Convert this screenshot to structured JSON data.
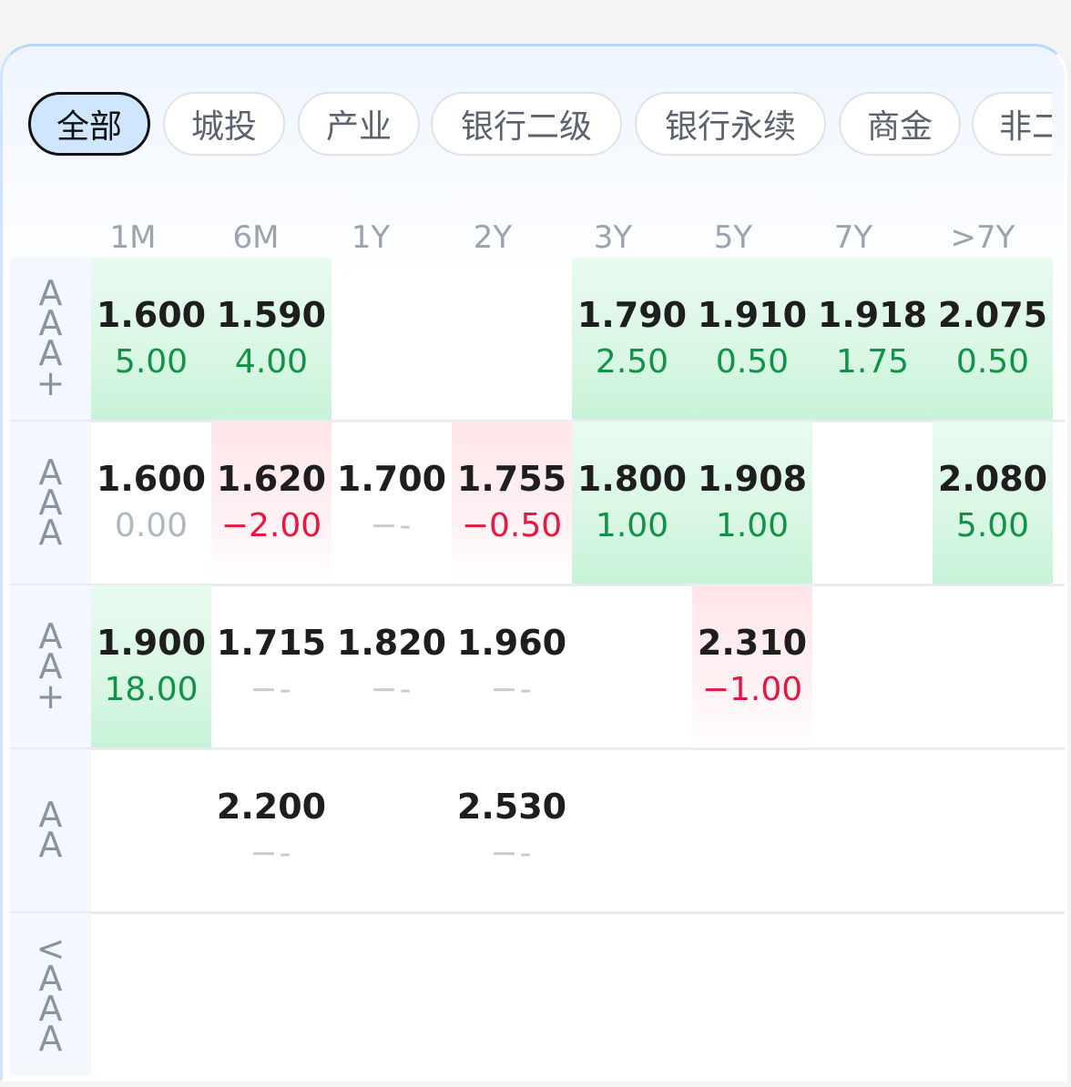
{
  "tabs": [
    "全部",
    "城投",
    "产业",
    "银行二级",
    "银行永续",
    "商金",
    "非二"
  ],
  "active_tab": 0,
  "columns": [
    "1M",
    "6M",
    "1Y",
    "2Y",
    "3Y",
    "5Y",
    "7Y",
    ">7Y"
  ],
  "rows": [
    {
      "label": [
        "A",
        "A",
        "A",
        "+"
      ],
      "cells": [
        {
          "yield": "1.600",
          "change": "5.00",
          "trend": "up"
        },
        {
          "yield": "1.590",
          "change": "4.00",
          "trend": "up"
        },
        null,
        null,
        {
          "yield": "1.790",
          "change": "2.50",
          "trend": "up"
        },
        {
          "yield": "1.910",
          "change": "0.50",
          "trend": "up"
        },
        {
          "yield": "1.918",
          "change": "1.75",
          "trend": "up"
        },
        {
          "yield": "2.075",
          "change": "0.50",
          "trend": "up"
        }
      ]
    },
    {
      "label": [
        "A",
        "A",
        "A"
      ],
      "cells": [
        {
          "yield": "1.600",
          "change": "0.00",
          "trend": "zero"
        },
        {
          "yield": "1.620",
          "change": "-2.00",
          "trend": "down"
        },
        {
          "yield": "1.700",
          "change": "--",
          "trend": "none"
        },
        {
          "yield": "1.755",
          "change": "-0.50",
          "trend": "down"
        },
        {
          "yield": "1.800",
          "change": "1.00",
          "trend": "up"
        },
        {
          "yield": "1.908",
          "change": "1.00",
          "trend": "up"
        },
        null,
        {
          "yield": "2.080",
          "change": "5.00",
          "trend": "up"
        }
      ]
    },
    {
      "label": [
        "A",
        "A",
        "+"
      ],
      "cells": [
        {
          "yield": "1.900",
          "change": "18.00",
          "trend": "up"
        },
        {
          "yield": "1.715",
          "change": "--",
          "trend": "none"
        },
        {
          "yield": "1.820",
          "change": "--",
          "trend": "none"
        },
        {
          "yield": "1.960",
          "change": "--",
          "trend": "none"
        },
        null,
        {
          "yield": "2.310",
          "change": "-1.00",
          "trend": "down"
        },
        null,
        null
      ]
    },
    {
      "label": [
        "A",
        "A"
      ],
      "cells": [
        null,
        {
          "yield": "2.200",
          "change": "--",
          "trend": "none"
        },
        null,
        {
          "yield": "2.530",
          "change": "--",
          "trend": "none"
        },
        null,
        null,
        null,
        null
      ]
    },
    {
      "label": [
        "<",
        "A",
        "A",
        "A"
      ],
      "cells": [
        null,
        null,
        null,
        null,
        null,
        null,
        null,
        null
      ]
    }
  ]
}
